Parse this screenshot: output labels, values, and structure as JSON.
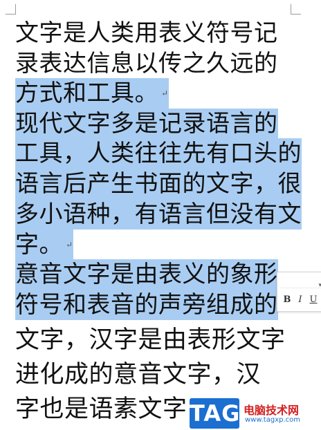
{
  "document": {
    "lines": [
      {
        "text": "文字是人类用表义符号记",
        "selected": false,
        "mark": ""
      },
      {
        "text": "录表达信息以传之久远的",
        "selected": false,
        "mark": ""
      },
      {
        "text": "方式和工具。",
        "selected": true,
        "mark": "↵"
      },
      {
        "text": "现代文字多是记录语言的",
        "selected": true,
        "mark": ""
      },
      {
        "text": "工具，人类往往先有口头的",
        "selected": true,
        "mark": ""
      },
      {
        "text": "语言后产生书面的文字，很",
        "selected": true,
        "mark": ""
      },
      {
        "text": "多小语种，有语言但没有文",
        "selected": true,
        "mark": ""
      },
      {
        "text": "字。",
        "selected": true,
        "mark": "↵"
      },
      {
        "text": "意音文字是由表义的象形",
        "selected": true,
        "mark": ""
      },
      {
        "text": "符号和表音的声旁组成的",
        "selected": true,
        "mark": ""
      },
      {
        "text": "文字，汉字是由表形文字",
        "selected": false,
        "mark": ""
      },
      {
        "text": "进化成的意音文字，汉",
        "selected": false,
        "mark": ""
      },
      {
        "text": "字也是语素文字",
        "selected": false,
        "mark": ""
      }
    ]
  },
  "mini_toolbar": {
    "bold": "B",
    "italic": "I",
    "underline": "U",
    "dropdown_icon": "chevron-down-icon"
  },
  "watermark": {
    "tag": "TAG",
    "site_name": "电脑技术网",
    "url": "www.tagxp.com"
  }
}
